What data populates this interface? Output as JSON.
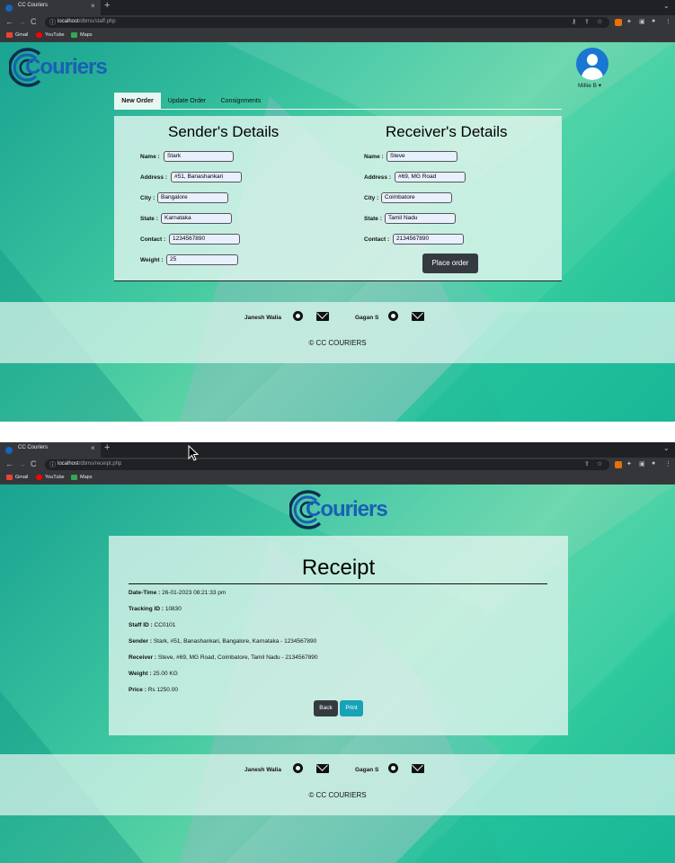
{
  "browser": {
    "tab_title": "CC Couriers",
    "tab_close": "×",
    "new_tab": "+",
    "tab_menu": "⌄",
    "nav_back": "←",
    "nav_forward": "→",
    "nav_reload": "C",
    "bookmarks": [
      {
        "label": "Gmail",
        "color": "#ea4335"
      },
      {
        "label": "YouTube",
        "color": "#ff0000"
      },
      {
        "label": "Maps",
        "color": "#34a853"
      }
    ]
  },
  "screen1": {
    "url_host": "localhost",
    "url_path": "/dbms/staff.php",
    "logo_text": "Couriers",
    "user_name": "Millie B",
    "nav_tabs": [
      "New Order",
      "Update Order",
      "Consignments"
    ],
    "sender": {
      "title": "Sender's Details",
      "fields": [
        {
          "label": "Name :",
          "value": "Stark"
        },
        {
          "label": "Address :",
          "value": "#51, Banashankari"
        },
        {
          "label": "City :",
          "value": "Bangalore"
        },
        {
          "label": "State :",
          "value": "Karnataka"
        },
        {
          "label": "Contact :",
          "value": "1234567890"
        },
        {
          "label": "Weight :",
          "value": "25"
        }
      ]
    },
    "receiver": {
      "title": "Receiver's Details",
      "fields": [
        {
          "label": "Name :",
          "value": "Steve"
        },
        {
          "label": "Address :",
          "value": "#69, MG Road"
        },
        {
          "label": "City :",
          "value": "Coimbatore"
        },
        {
          "label": "State :",
          "value": "Tamil Nadu"
        },
        {
          "label": "Contact :",
          "value": "2134567890"
        }
      ]
    },
    "place_order_label": "Place order"
  },
  "screen2": {
    "url_host": "localhost",
    "url_path": "/dbms/receipt.php",
    "logo_text": "Couriers",
    "receipt_title": "Receipt",
    "rows": [
      {
        "label": "Date-Time :",
        "value": "26-01-2023 08:21:33 pm"
      },
      {
        "label": "Tracking ID :",
        "value": "10830"
      },
      {
        "label": "Staff ID :",
        "value": "CC0101"
      },
      {
        "label": "Sender :",
        "value": "Stark, #51, Banashankari, Bangalore, Karnataka - 1234567890"
      },
      {
        "label": "Receiver :",
        "value": "Steve, #69, MG Road, Coimbatore, Tamil Nadu - 2134567890"
      },
      {
        "label": "Weight :",
        "value": "25.00 KG"
      },
      {
        "label": "Price :",
        "value": "Rs 1250.00"
      }
    ],
    "back_label": "Back",
    "print_label": "Print"
  },
  "footer": {
    "author1": "Janesh Walia",
    "author2": "Gagan S",
    "copyright": "© CC COURIERS"
  },
  "colors": {
    "brand": "#1a5fb4",
    "accent": "#17a2b8",
    "dark_button": "#343a40"
  }
}
